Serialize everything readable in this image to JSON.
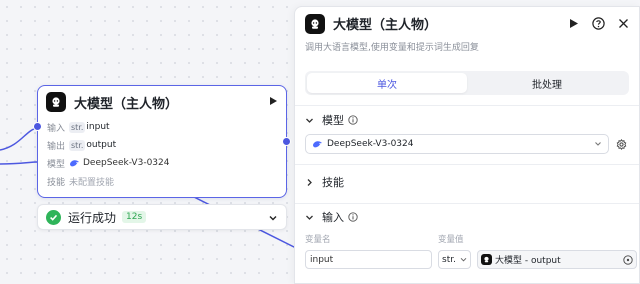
{
  "node": {
    "title": "大模型（主人物）",
    "input_label": "输入",
    "input_type": "str.",
    "input_name": "input",
    "output_label": "输出",
    "output_type": "str.",
    "output_name": "output",
    "model_label": "模型",
    "model_value": "DeepSeek-V3-0324",
    "skill_label": "技能",
    "skill_value": "未配置技能"
  },
  "run_status": {
    "text": "运行成功",
    "time": "12s"
  },
  "panel": {
    "title": "大模型（主人物）",
    "description": "调用大语言模型,使用变量和提示词生成回复",
    "tabs": [
      "单次",
      "批处理"
    ],
    "model_section": "模型",
    "model_value": "DeepSeek-V3-0324",
    "skill_section": "技能",
    "input_section": "输入",
    "col_name": "变量名",
    "col_value": "变量值",
    "row_name": "input",
    "row_type": "str.",
    "row_ref": "大模型 - output"
  },
  "colors": {
    "accent": "#4d58e0",
    "success": "#2fb45a"
  }
}
